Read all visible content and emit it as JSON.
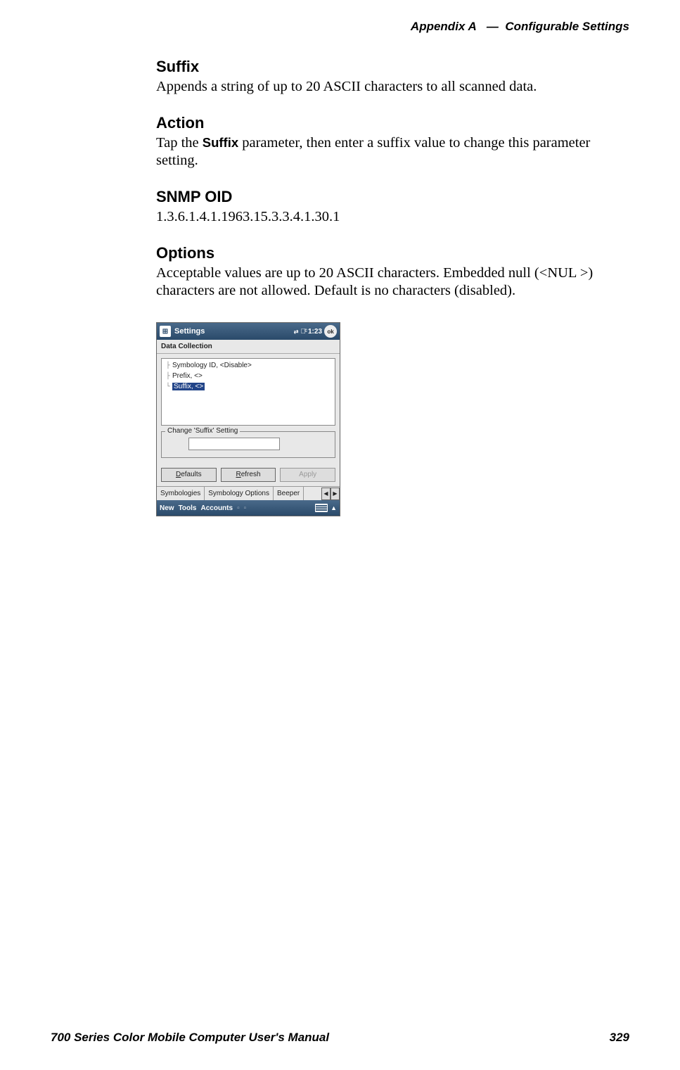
{
  "header": {
    "appendix": "Appendix A",
    "sep": "—",
    "title": "Configurable Settings"
  },
  "sections": {
    "suffix": {
      "heading": "Suffix",
      "text": "Appends a string of up to 20 ASCII characters to all scanned data."
    },
    "action": {
      "heading": "Action",
      "text_pre": "Tap the ",
      "text_bold": "Suffix",
      "text_post": " parameter, then enter a suffix value to change this parameter setting."
    },
    "snmp": {
      "heading": "SNMP OID",
      "text": "1.3.6.1.4.1.1963.15.3.3.4.1.30.1"
    },
    "options": {
      "heading": "Options",
      "text": "Acceptable values are up to 20 ASCII characters. Embedded null (<NUL >) characters are not allowed. Default is no characters (disabled)."
    }
  },
  "screenshot": {
    "titlebar": {
      "title": "Settings",
      "time": "1:23",
      "ok": "ok"
    },
    "subtitle": "Data Collection",
    "tree": {
      "item1": "Symbology ID, <Disable>",
      "item2": "Prefix, <>",
      "item3": "Suffix, <>"
    },
    "fieldset_legend": "Change 'Suffix' Setting",
    "buttons": {
      "defaults_u": "D",
      "defaults_rest": "efaults",
      "refresh_u": "R",
      "refresh_rest": "efresh",
      "apply": "Apply"
    },
    "tabs": {
      "t1": "Symbologies",
      "t2": "Symbology Options",
      "t3": "Beeper"
    },
    "bottombar": {
      "new": "New",
      "tools": "Tools",
      "accounts": "Accounts"
    }
  },
  "footer": {
    "left": "700 Series Color Mobile Computer User's Manual",
    "right": "329"
  }
}
